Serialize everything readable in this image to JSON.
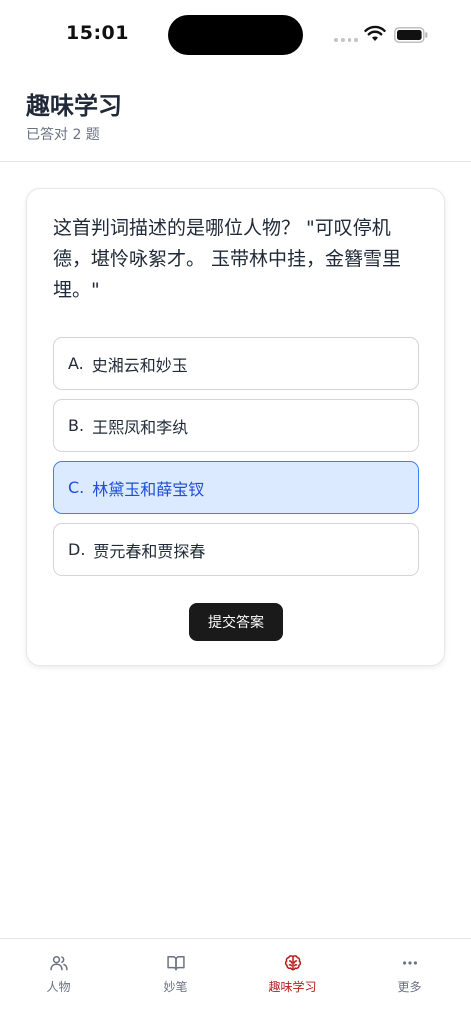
{
  "status_bar": {
    "time": "15:01"
  },
  "header": {
    "title": "趣味学习",
    "subtitle": "已答对 2 题"
  },
  "quiz": {
    "question": "这首判词描述的是哪位人物？ \"可叹停机德，堪怜咏絮才。 玉带林中挂，金簪雪里埋。\"",
    "options": [
      {
        "letter": "A.",
        "text": "史湘云和妙玉"
      },
      {
        "letter": "B.",
        "text": "王熙凤和李纨"
      },
      {
        "letter": "C.",
        "text": "林黛玉和薛宝钗"
      },
      {
        "letter": "D.",
        "text": "贾元春和贾探春"
      }
    ],
    "selected_option": "C",
    "submit_label": "提交答案"
  },
  "tabs": [
    {
      "label": "人物",
      "icon": "people-icon"
    },
    {
      "label": "妙笔",
      "icon": "book-icon"
    },
    {
      "label": "趣味学习",
      "icon": "brain-icon",
      "active": true
    },
    {
      "label": "更多",
      "icon": "more-icon"
    }
  ],
  "colors": {
    "accent_active": "#b91c1c",
    "selected_bg": "#dbeafe",
    "selected_border": "#3b82f6",
    "selected_text": "#1d4ed8",
    "button_bg": "#1a1a1a"
  }
}
